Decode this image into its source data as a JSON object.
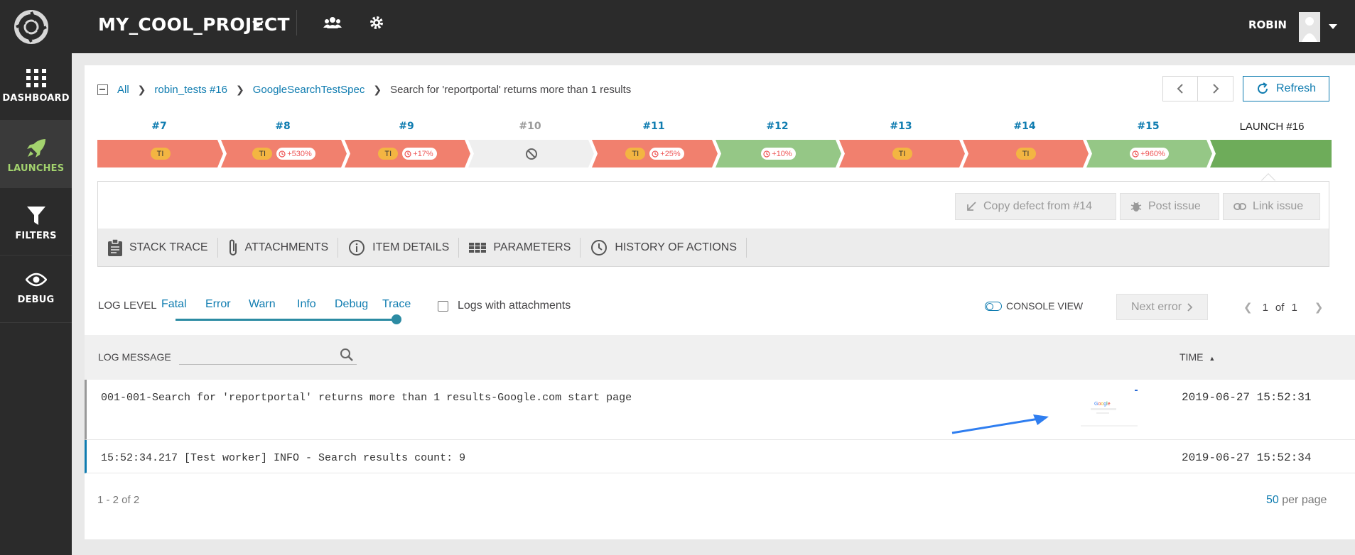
{
  "app": {
    "project_name": "MY_COOL_PROJECT",
    "user_name": "ROBIN"
  },
  "sidebar": {
    "items": [
      {
        "label": "DASHBOARD",
        "icon": "grid-icon"
      },
      {
        "label": "LAUNCHES",
        "icon": "rocket-icon",
        "active": true
      },
      {
        "label": "FILTERS",
        "icon": "filter-icon"
      },
      {
        "label": "DEBUG",
        "icon": "eye-icon"
      }
    ]
  },
  "breadcrumb": {
    "items": [
      "All",
      "robin_tests #16",
      "GoogleSearchTestSpec"
    ],
    "current": "Search for 'reportportal' returns more than 1 results"
  },
  "toolbar": {
    "refresh_label": "Refresh"
  },
  "history": {
    "items": [
      {
        "label": "#7",
        "status": "failed",
        "defect": "TI",
        "growth": ""
      },
      {
        "label": "#8",
        "status": "failed",
        "defect": "TI",
        "growth": "+530%"
      },
      {
        "label": "#9",
        "status": "failed",
        "defect": "TI",
        "growth": "+17%"
      },
      {
        "label": "#10",
        "status": "skipped",
        "defect": "",
        "growth": ""
      },
      {
        "label": "#11",
        "status": "failed",
        "defect": "TI",
        "growth": "+25%"
      },
      {
        "label": "#12",
        "status": "passed",
        "defect": "",
        "growth": "+10%"
      },
      {
        "label": "#13",
        "status": "failed",
        "defect": "TI",
        "growth": ""
      },
      {
        "label": "#14",
        "status": "failed",
        "defect": "TI",
        "growth": ""
      },
      {
        "label": "#15",
        "status": "passed",
        "defect": "",
        "growth": "+960%"
      },
      {
        "label": "LAUNCH #16",
        "status": "passed-current",
        "defect": "",
        "growth": ""
      }
    ],
    "colors": {
      "failed": "#f1806e",
      "passed": "#95c786",
      "current": "#6eac5a",
      "skipped": "#efefef"
    }
  },
  "defect_actions": {
    "copy_label": "Copy defect from #14",
    "post_label": "Post issue",
    "link_label": "Link issue"
  },
  "tabs": [
    "STACK TRACE",
    "ATTACHMENTS",
    "ITEM DETAILS",
    "PARAMETERS",
    "HISTORY OF ACTIONS"
  ],
  "log_controls": {
    "log_level_label": "LOG LEVEL",
    "levels": [
      "Fatal",
      "Error",
      "Warn",
      "Info",
      "Debug",
      "Trace"
    ],
    "selected_level": "Trace",
    "attachments_label": "Logs with attachments",
    "console_view_label": "CONSOLE VIEW",
    "next_error_label": "Next error",
    "page_current": "1",
    "page_of": "of",
    "page_total": "1"
  },
  "table": {
    "col_message": "LOG MESSAGE",
    "col_time": "TIME",
    "rows": [
      {
        "message": "001-001-Search for 'reportportal' returns more than 1 results-Google.com start page",
        "time": "2019-06-27 15:52:31",
        "has_attachment": true
      },
      {
        "message": "15:52:34.217 [Test worker] INFO - Search results count: 9",
        "time": "2019-06-27 15:52:34",
        "has_attachment": false
      }
    ],
    "count_text": "1 - 2 of 2",
    "per_page_value": "50",
    "per_page_label": "per page"
  },
  "accent_color": "#0f7cb0"
}
